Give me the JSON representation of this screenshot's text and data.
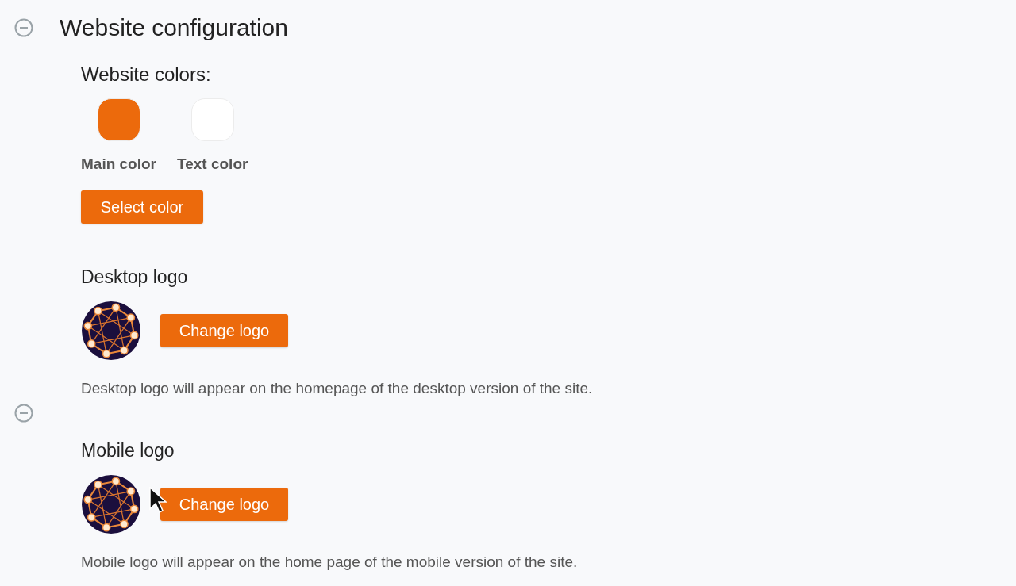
{
  "section": {
    "title": "Website configuration",
    "expanded": true
  },
  "colors": {
    "heading": "Website colors:",
    "swatches": [
      {
        "label": "Main color",
        "color": "#ec6a0c"
      },
      {
        "label": "Text color",
        "color": "#ffffff"
      }
    ],
    "button": "Select color"
  },
  "logos": [
    {
      "heading": "Desktop logo",
      "button": "Change logo",
      "description": "Desktop logo will appear on the homepage of the desktop version of the site."
    },
    {
      "toggle": {
        "expanded": true
      },
      "heading": "Mobile logo",
      "button": "Change logo",
      "description": "Mobile logo will appear on the home page of the mobile version of the site."
    }
  ]
}
